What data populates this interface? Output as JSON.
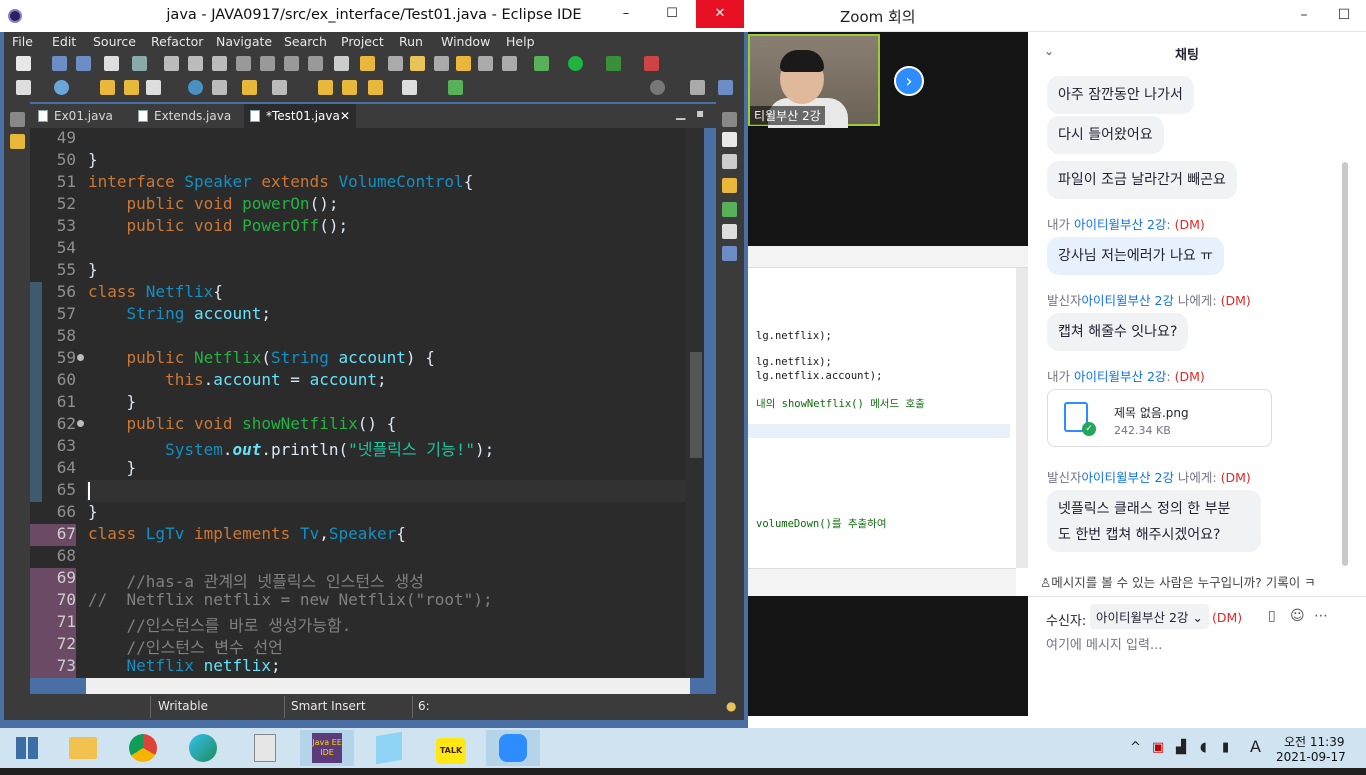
{
  "eclipse": {
    "title": "java - JAVA0917/src/ex_interface/Test01.java - Eclipse IDE",
    "window_controls": [
      "–",
      "☐",
      "✕"
    ],
    "menu": [
      "File",
      "Edit",
      "Source",
      "Refactor",
      "Navigate",
      "Search",
      "Project",
      "Run",
      "Window",
      "Help"
    ],
    "tabs": [
      {
        "label": "Ex01.java"
      },
      {
        "label": "Extends.java"
      },
      {
        "label": "*Test01.java",
        "close": "✕"
      }
    ],
    "code": [
      {
        "n": "49"
      },
      {
        "n": "50",
        "t": [
          {
            "c": "",
            "s": "}"
          }
        ]
      },
      {
        "n": "51",
        "t": [
          {
            "c": "kw",
            "s": "interface "
          },
          {
            "c": "ty",
            "s": "Speaker "
          },
          {
            "c": "kw",
            "s": "extends "
          },
          {
            "c": "ty",
            "s": "VolumeControl"
          },
          {
            "c": "",
            "s": "{"
          }
        ]
      },
      {
        "n": "52",
        "t": [
          {
            "c": "",
            "s": "    "
          },
          {
            "c": "kw",
            "s": "public void "
          },
          {
            "c": "fn",
            "s": "powerOn"
          },
          {
            "c": "",
            "s": "();"
          }
        ]
      },
      {
        "n": "53",
        "t": [
          {
            "c": "",
            "s": "    "
          },
          {
            "c": "kw",
            "s": "public void "
          },
          {
            "c": "fn",
            "s": "PowerOff"
          },
          {
            "c": "",
            "s": "();"
          }
        ]
      },
      {
        "n": "54"
      },
      {
        "n": "55",
        "t": [
          {
            "c": "",
            "s": "}"
          }
        ]
      },
      {
        "n": "56",
        "t": [
          {
            "c": "kw",
            "s": "class "
          },
          {
            "c": "ty",
            "s": "Netflix"
          },
          {
            "c": "",
            "s": "{"
          }
        ]
      },
      {
        "n": "57",
        "t": [
          {
            "c": "",
            "s": "    "
          },
          {
            "c": "ty",
            "s": "String "
          },
          {
            "c": "fd",
            "s": "account"
          },
          {
            "c": "",
            "s": ";"
          }
        ]
      },
      {
        "n": "58"
      },
      {
        "n": "59",
        "fold": true,
        "t": [
          {
            "c": "",
            "s": "    "
          },
          {
            "c": "kw",
            "s": "public "
          },
          {
            "c": "fn",
            "s": "Netflix"
          },
          {
            "c": "",
            "s": "("
          },
          {
            "c": "ty",
            "s": "String "
          },
          {
            "c": "fd",
            "s": "account"
          },
          {
            "c": "",
            "s": ") {"
          }
        ]
      },
      {
        "n": "60",
        "t": [
          {
            "c": "",
            "s": "        "
          },
          {
            "c": "kw",
            "s": "this"
          },
          {
            "c": "",
            "s": "."
          },
          {
            "c": "fd",
            "s": "account"
          },
          {
            "c": "",
            "s": " = "
          },
          {
            "c": "fd",
            "s": "account"
          },
          {
            "c": "",
            "s": ";"
          }
        ]
      },
      {
        "n": "61",
        "t": [
          {
            "c": "",
            "s": "    }"
          }
        ]
      },
      {
        "n": "62",
        "fold": true,
        "t": [
          {
            "c": "",
            "s": "    "
          },
          {
            "c": "kw",
            "s": "public void "
          },
          {
            "c": "fn",
            "s": "showNetfilix"
          },
          {
            "c": "",
            "s": "() {"
          }
        ]
      },
      {
        "n": "63",
        "t": [
          {
            "c": "",
            "s": "        "
          },
          {
            "c": "ty",
            "s": "System"
          },
          {
            "c": "",
            "s": "."
          },
          {
            "c": "fd it",
            "s": "out"
          },
          {
            "c": "",
            "s": ".println("
          },
          {
            "c": "st",
            "s": "\"넷플릭스 기능!\""
          },
          {
            "c": "",
            "s": ");"
          }
        ]
      },
      {
        "n": "64",
        "t": [
          {
            "c": "",
            "s": "    }"
          }
        ]
      },
      {
        "n": "65",
        "t": [
          {
            "c": "",
            "s": ""
          }
        ]
      },
      {
        "n": "66",
        "t": [
          {
            "c": "",
            "s": "}"
          }
        ]
      },
      {
        "n": "67",
        "hl": true,
        "t": [
          {
            "c": "kw",
            "s": "class "
          },
          {
            "c": "ty",
            "s": "LgTv "
          },
          {
            "c": "kw",
            "s": "implements "
          },
          {
            "c": "ty",
            "s": "Tv"
          },
          {
            "c": "",
            "s": ","
          },
          {
            "c": "ty",
            "s": "Speaker"
          },
          {
            "c": "",
            "s": "{"
          }
        ]
      },
      {
        "n": "68"
      },
      {
        "n": "69",
        "hl": true,
        "t": [
          {
            "c": "cm",
            "s": "    //has-a 관계의 넷플릭스 인스턴스 생성"
          }
        ]
      },
      {
        "n": "70",
        "hl": true,
        "t": [
          {
            "c": "cm",
            "s": "//  Netflix netflix = new Netflix(\"root\");"
          }
        ]
      },
      {
        "n": "71",
        "hl": true,
        "t": [
          {
            "c": "cm",
            "s": "    //인스턴스를 바로 생성가능함."
          }
        ]
      },
      {
        "n": "72",
        "hl": true,
        "t": [
          {
            "c": "cm",
            "s": "    //인스턴스 변수 선언"
          }
        ]
      },
      {
        "n": "73",
        "hl": true,
        "t": [
          {
            "c": "",
            "s": "    "
          },
          {
            "c": "ty",
            "s": "Netflix "
          },
          {
            "c": "fd",
            "s": "netflix"
          },
          {
            "c": "",
            "s": ";"
          }
        ]
      }
    ],
    "status": {
      "mode": "Writable",
      "insert": "Smart Insert",
      "pos": "6:"
    }
  },
  "zoom": {
    "title": "Zoom 회의",
    "participant_name": "티윌부산 2강",
    "chat_title": "채팅",
    "messages": [
      {
        "type": "bubble",
        "text": "아주 잠깐동안 나가서"
      },
      {
        "type": "bubble",
        "text": "다시 들어왔어요"
      },
      {
        "type": "bubble",
        "text": "파일이 조금 날라간거 빼곤요"
      },
      {
        "type": "meta",
        "prefix": "내가 ",
        "who": "아이티윌부산 2강",
        "suffix": ":",
        "dm": "(DM)"
      },
      {
        "type": "bubble-blue",
        "text": "강사님 저는에러가 나요 ㅠ"
      },
      {
        "type": "meta",
        "prefix": "발신자",
        "who": "아이티윌부산 2강",
        "suffix": " 나에게:",
        "dm": "(DM)"
      },
      {
        "type": "bubble",
        "text": "캡쳐 해줄수 잇나요?"
      },
      {
        "type": "meta",
        "prefix": "내가 ",
        "who": "아이티윌부산 2강",
        "suffix": ":",
        "dm": "(DM)"
      },
      {
        "type": "meta",
        "prefix": "발신자",
        "who": "아이티윌부산 2강",
        "suffix": " 나에게:",
        "dm": "(DM)"
      },
      {
        "type": "bubble",
        "text": "넷플릭스 클래스 정의 한 부분"
      },
      {
        "type": "bubble",
        "text": "도 한번 캡쳐 해주시겠어요?"
      }
    ],
    "file": {
      "name": "제목 없음.png",
      "size": "242.34 KB"
    },
    "who_can_see": "메시지를 볼 수 있는 사람은 누구입니까? 기록이 ㅋ",
    "recipient_label": "수신자:",
    "recipient_value": "아이티윌부산 2강 ⌄",
    "recipient_dm": "(DM)",
    "input_placeholder": "여기에 메시지 입력...",
    "shared_screen": [
      {
        "text": "lg.netflix);"
      },
      {
        "text": "lg.netflix);"
      },
      {
        "text": "lg.netflix.account);"
      },
      {
        "text": "내의 showNetflix() 메서드 호출"
      },
      {
        "text": "volumeDown()를 추출하여"
      }
    ]
  },
  "taskbar": {
    "apps": [
      "start",
      "file-explorer",
      "chrome",
      "edge",
      "calculator",
      "eclipse",
      "notepad",
      "kakaotalk",
      "zoom"
    ],
    "time": "오전 11:39",
    "date": "2021-09-17",
    "ime": "A"
  }
}
